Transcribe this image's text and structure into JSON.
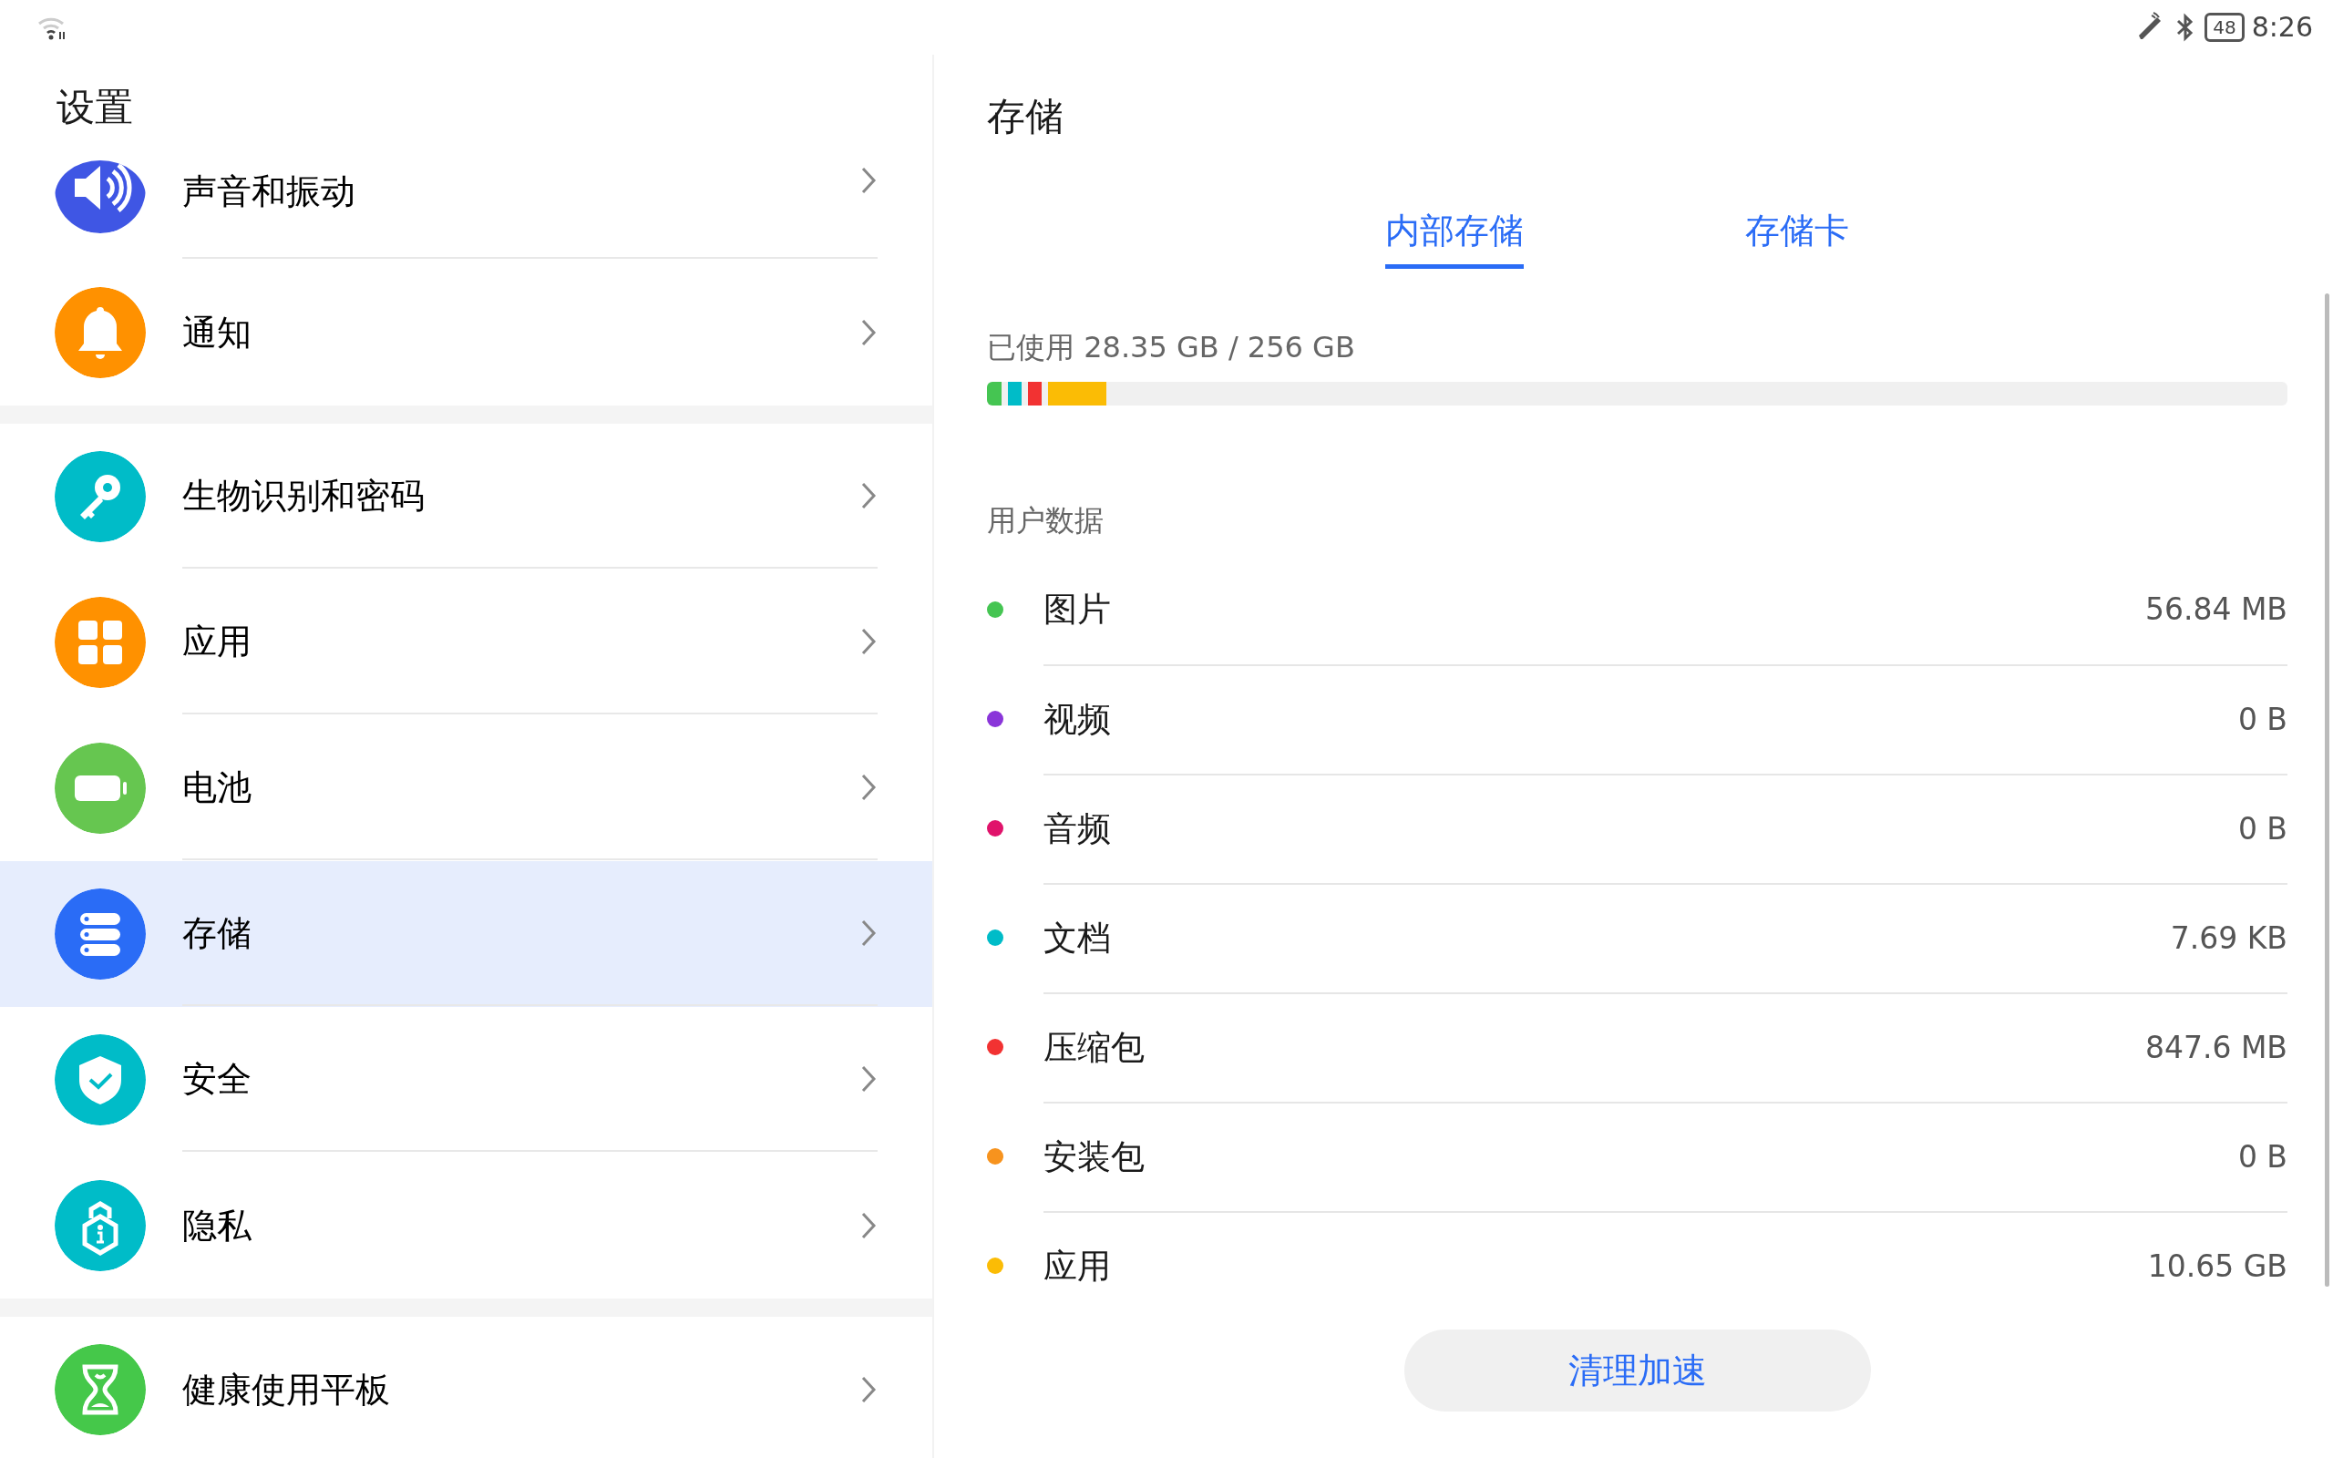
{
  "status_bar": {
    "battery": "48",
    "time": "8:26"
  },
  "sidebar": {
    "title": "设置",
    "groups": [
      {
        "items": [
          {
            "label": "声音和振动",
            "selected": false
          },
          {
            "label": "通知",
            "selected": false
          }
        ]
      },
      {
        "items": [
          {
            "label": "生物识别和密码",
            "selected": false
          },
          {
            "label": "应用",
            "selected": false
          },
          {
            "label": "电池",
            "selected": false
          },
          {
            "label": "存储",
            "selected": true
          },
          {
            "label": "安全",
            "selected": false
          },
          {
            "label": "隐私",
            "selected": false
          }
        ]
      },
      {
        "items": [
          {
            "label": "健康使用平板",
            "selected": false
          }
        ]
      }
    ]
  },
  "detail": {
    "title": "存储",
    "tabs": [
      {
        "label": "内部存储",
        "selected": true
      },
      {
        "label": "存储卡",
        "selected": false
      }
    ],
    "usage": "已使用 28.35 GB / 256 GB",
    "segments": [
      {
        "color": "#45c552",
        "level": 0.011
      },
      {
        "color": "#00bcc8",
        "level": 0.011
      },
      {
        "color": "#f23232",
        "level": 0.01
      },
      {
        "color": "#fbbc05",
        "level": 0.045
      }
    ],
    "section": "用户数据",
    "categories": [
      {
        "label": "图片",
        "value": "56.84 MB",
        "color": "#45c552"
      },
      {
        "label": "视频",
        "value": "0 B",
        "color": "#8a35d9"
      },
      {
        "label": "音频",
        "value": "0 B",
        "color": "#e0136b"
      },
      {
        "label": "文档",
        "value": "7.69 KB",
        "color": "#00bcc8"
      },
      {
        "label": "压缩包",
        "value": "847.6 MB",
        "color": "#f23232"
      },
      {
        "label": "安装包",
        "value": "0 B",
        "color": "#f7931e"
      },
      {
        "label": "应用",
        "value": "10.65 GB",
        "color": "#fbbc05"
      }
    ],
    "button": "清理加速"
  }
}
